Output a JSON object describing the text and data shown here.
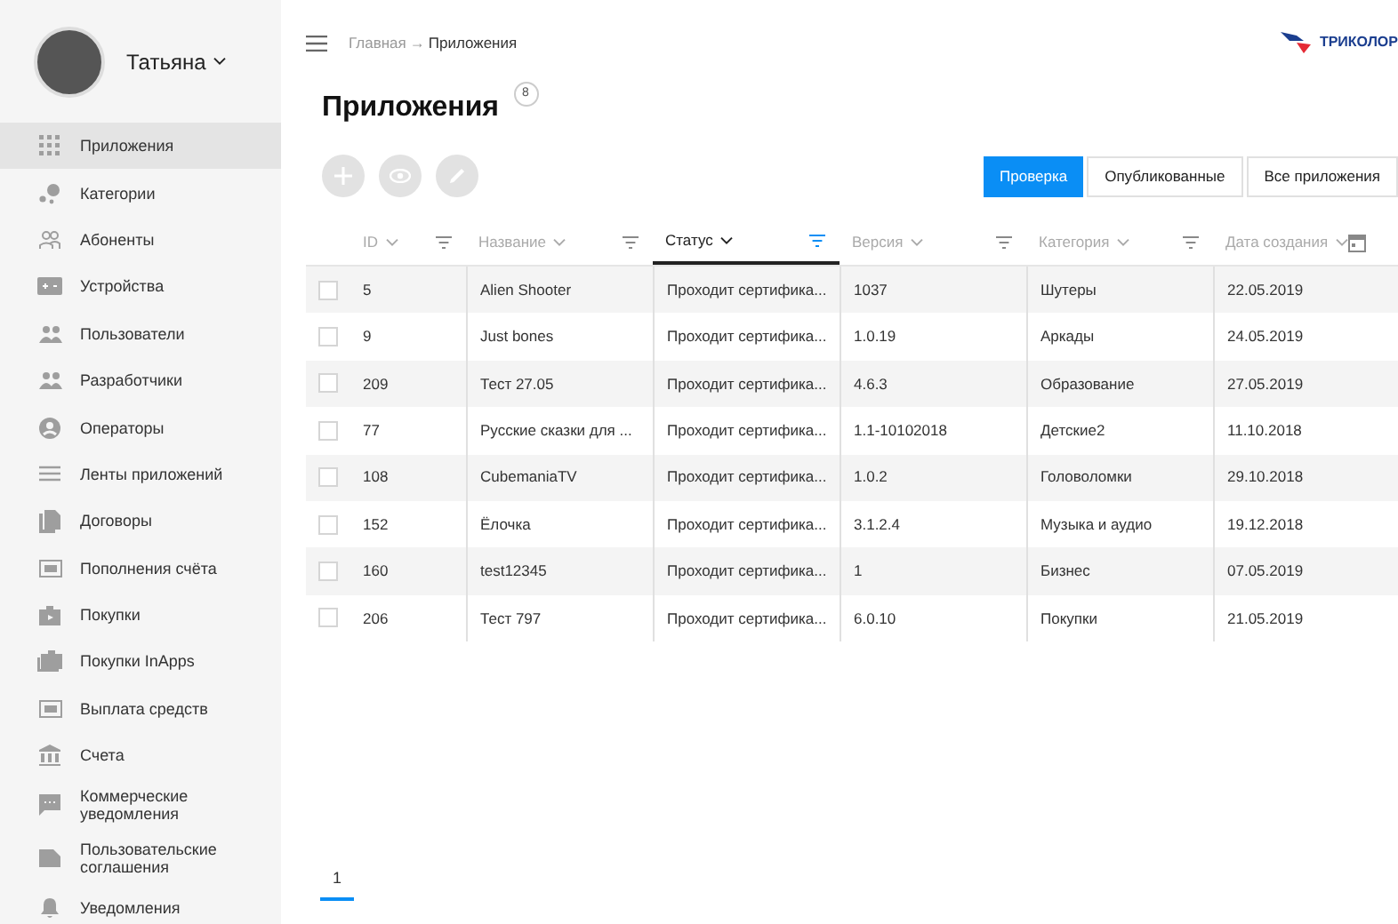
{
  "user": {
    "name": "Татьяна"
  },
  "sidebar": {
    "items": [
      {
        "label": "Приложения",
        "selected": true
      },
      {
        "label": "Категории",
        "selected": false
      },
      {
        "label": "Абоненты",
        "selected": false
      },
      {
        "label": "Устройства",
        "selected": false
      },
      {
        "label": "Пользователи",
        "selected": false
      },
      {
        "label": "Разработчики",
        "selected": false
      },
      {
        "label": "Операторы",
        "selected": false
      },
      {
        "label": "Ленты приложений",
        "selected": false
      },
      {
        "label": "Договоры",
        "selected": false
      },
      {
        "label": "Пополнения счёта",
        "selected": false
      },
      {
        "label": "Покупки",
        "selected": false
      },
      {
        "label": "Покупки InApps",
        "selected": false
      },
      {
        "label": "Выплата средств",
        "selected": false
      },
      {
        "label": "Счета",
        "selected": false
      },
      {
        "label": "Коммерческие уведомления",
        "selected": false
      },
      {
        "label": "Пользовательские соглашения",
        "selected": false
      },
      {
        "label": "Уведомления",
        "selected": false
      }
    ]
  },
  "breadcrumb": {
    "parent": "Главная",
    "separator": "→",
    "current": "Приложения"
  },
  "logo": {
    "text": "ТРИКОЛОР"
  },
  "page": {
    "title": "Приложения",
    "count": "8"
  },
  "tabs": [
    {
      "label": "Проверка",
      "selected": true
    },
    {
      "label": "Опубликованные",
      "selected": false
    },
    {
      "label": "Все приложения",
      "selected": false
    }
  ],
  "table": {
    "columns": [
      {
        "label": "ID",
        "sorted": false
      },
      {
        "label": "Название",
        "sorted": false
      },
      {
        "label": "Статус",
        "sorted": true
      },
      {
        "label": "Версия",
        "sorted": false
      },
      {
        "label": "Категория",
        "sorted": false
      },
      {
        "label": "Дата создания",
        "sorted": false
      }
    ],
    "rows": [
      {
        "checked": false,
        "cells": [
          "5",
          "Alien Shooter",
          "Проходит сертифика...",
          "1037",
          "Шутеры",
          "22.05.2019"
        ]
      },
      {
        "checked": false,
        "cells": [
          "9",
          "Just bones",
          "Проходит сертифика...",
          "1.0.19",
          "Аркады",
          "24.05.2019"
        ]
      },
      {
        "checked": false,
        "cells": [
          "209",
          "Тест 27.05",
          "Проходит сертифика...",
          "4.6.3",
          "Образование",
          "27.05.2019"
        ]
      },
      {
        "checked": false,
        "cells": [
          "77",
          "Русские сказки для ...",
          "Проходит сертифика...",
          "1.1-10102018",
          "Детские2",
          "11.10.2018"
        ]
      },
      {
        "checked": false,
        "cells": [
          "108",
          "CubemaniaTV",
          "Проходит сертифика...",
          "1.0.2",
          "Головоломки",
          "29.10.2018"
        ]
      },
      {
        "checked": false,
        "cells": [
          "152",
          "Ёлочка",
          "Проходит сертифика...",
          "3.1.2.4",
          "Музыка и аудио",
          "19.12.2018"
        ]
      },
      {
        "checked": false,
        "cells": [
          "160",
          "test12345",
          "Проходит сертифика...",
          "1",
          "Бизнес",
          "07.05.2019"
        ]
      },
      {
        "checked": false,
        "cells": [
          "206",
          "Тест 797",
          "Проходит сертифика...",
          "6.0.10",
          "Покупки",
          "21.05.2019"
        ]
      }
    ]
  },
  "pagination": [
    {
      "label": "1",
      "selected": true
    }
  ]
}
